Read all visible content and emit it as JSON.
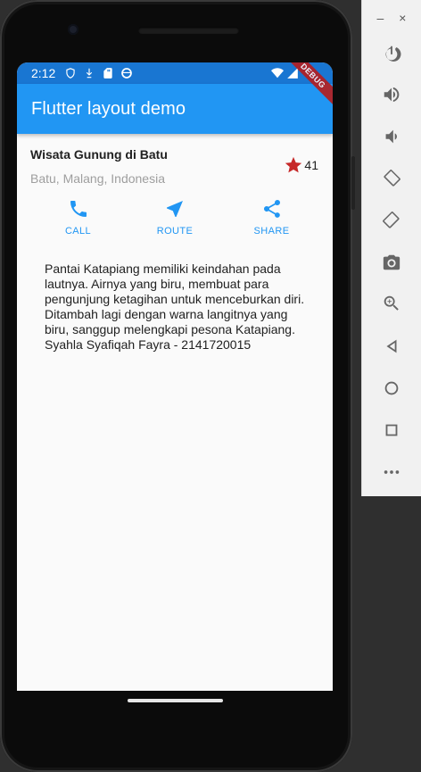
{
  "status_bar": {
    "time": "2:12"
  },
  "app_bar": {
    "title": "Flutter layout demo"
  },
  "debug_banner": "DEBUG",
  "place": {
    "name": "Wisata Gunung di Batu",
    "location": "Batu, Malang, Indonesia",
    "rating_count": "41",
    "star_color": "#c62828"
  },
  "actions": [
    {
      "label": "CALL",
      "icon": "call-icon"
    },
    {
      "label": "ROUTE",
      "icon": "near-me-icon"
    },
    {
      "label": "SHARE",
      "icon": "share-icon"
    }
  ],
  "description": "Pantai Katapiang memiliki keindahan pada lautnya. Airnya yang biru, membuat para pengunjung ketagihan untuk menceburkan diri. Ditambah lagi dengan warna langitnya yang biru, sanggup melengkapi pesona Katapiang. Syahla Syafiqah Fayra - 2141720015",
  "emulator_toolbar": {
    "minimize": "–",
    "close": "×",
    "buttons": [
      "power-icon",
      "volume-up-icon",
      "volume-down-icon",
      "rotate-left-icon",
      "rotate-right-icon",
      "camera-icon",
      "zoom-icon",
      "back-icon",
      "home-icon",
      "overview-icon",
      "more-icon"
    ]
  },
  "colors": {
    "primary": "#2196f3",
    "status_bar": "#1976d2",
    "accent_text": "#2196f3"
  }
}
